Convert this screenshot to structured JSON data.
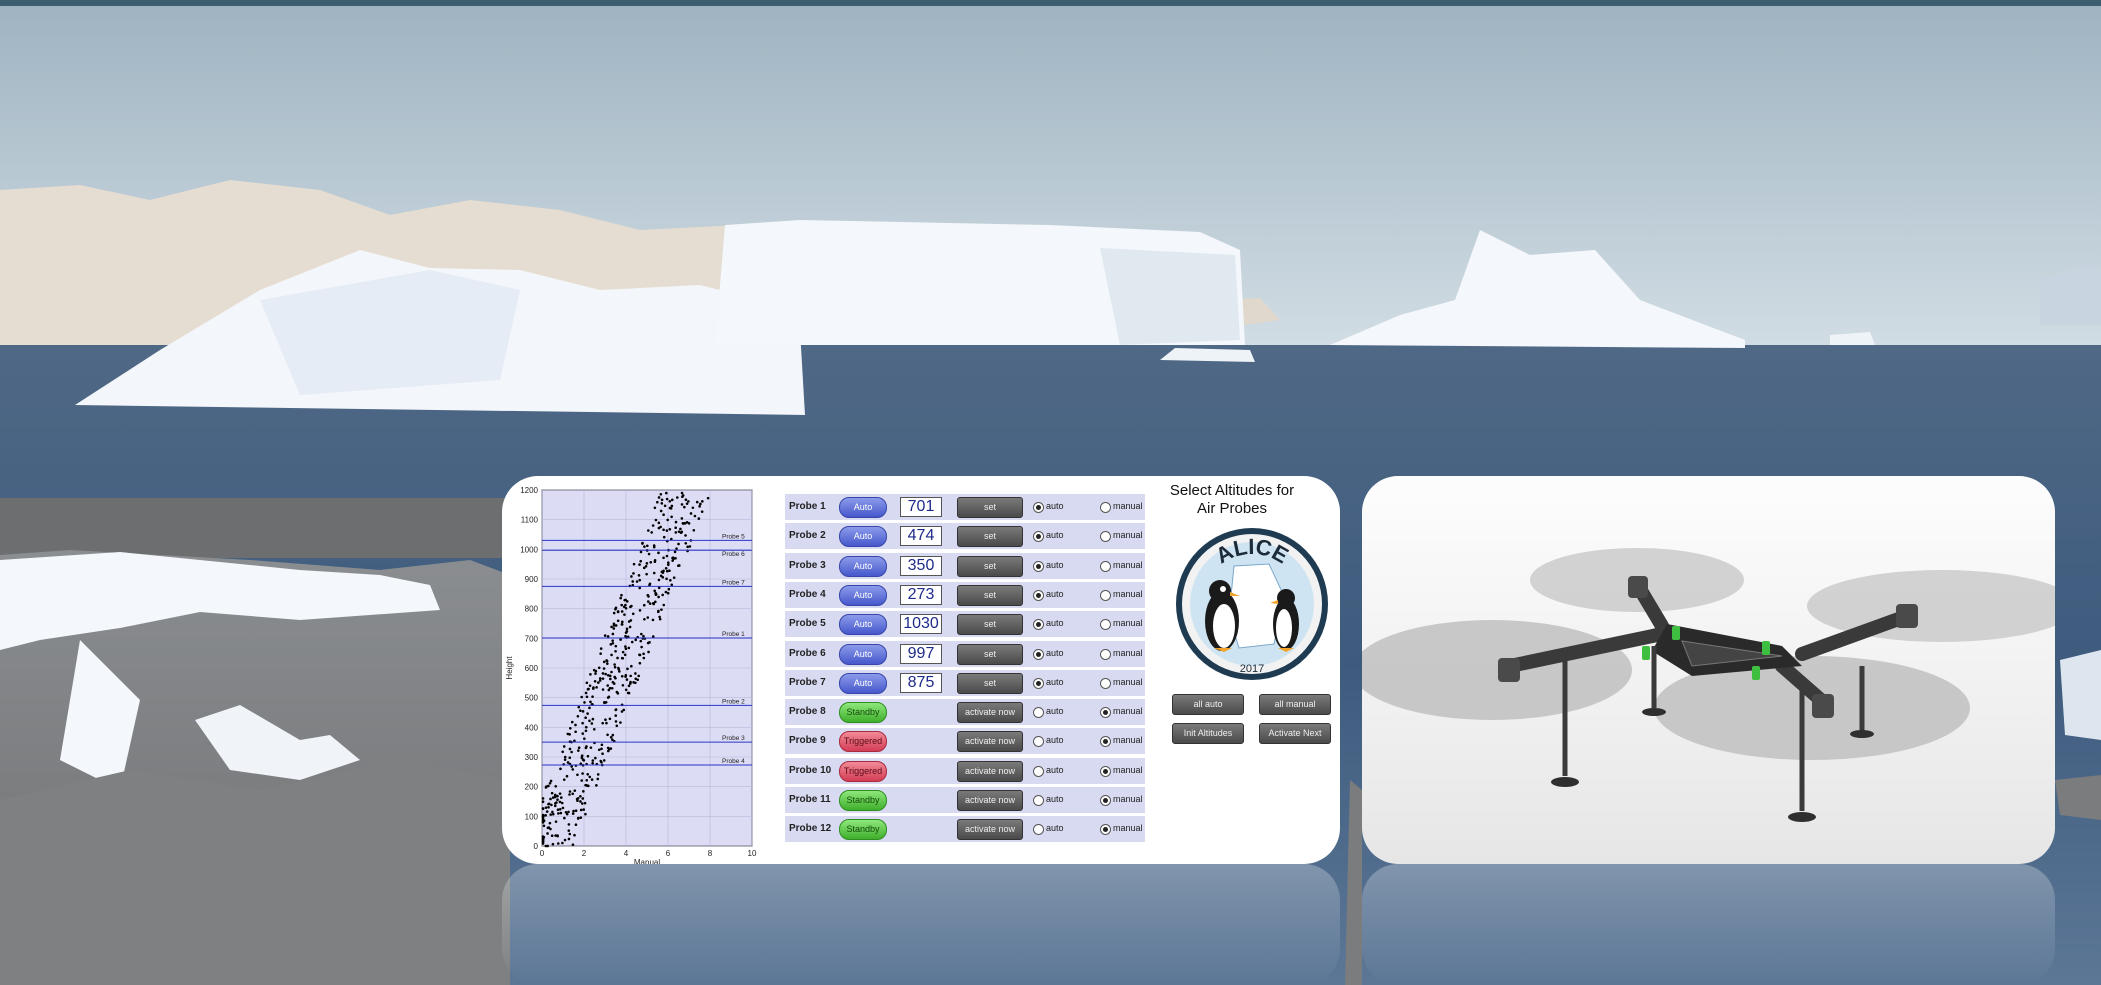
{
  "chart_data": {
    "type": "scatter",
    "xlabel": "Manual",
    "ylabel": "Height",
    "xlim": [
      0,
      10
    ],
    "ylim": [
      0,
      1200
    ],
    "x_ticks": [
      "0",
      "2",
      "4",
      "6",
      "8",
      "10"
    ],
    "y_ticks": [
      "0",
      "100",
      "200",
      "300",
      "400",
      "500",
      "600",
      "700",
      "800",
      "900",
      "1000",
      "1100",
      "1200"
    ],
    "probe_lines": [
      {
        "label": "Probe 5",
        "y": 1030
      },
      {
        "label": "Probe 6",
        "y": 997
      },
      {
        "label": "Probe 7",
        "y": 875
      },
      {
        "label": "Probe 1",
        "y": 701
      },
      {
        "label": "Probe 2",
        "y": 474
      },
      {
        "label": "Probe 3",
        "y": 350
      },
      {
        "label": "Probe 4",
        "y": 273
      }
    ],
    "scatter_note": "dense cloud of points drifting from x≈0 at height 0 to x≈7 at height 1200",
    "colors": {
      "background": "#dcdcf4",
      "line": "#2a35c8",
      "points": "#000000"
    }
  },
  "probes": [
    {
      "name": "Probe 1",
      "status": "Auto",
      "status_type": "auto",
      "altitude": "701",
      "action": "set",
      "mode": "auto"
    },
    {
      "name": "Probe 2",
      "status": "Auto",
      "status_type": "auto",
      "altitude": "474",
      "action": "set",
      "mode": "auto"
    },
    {
      "name": "Probe 3",
      "status": "Auto",
      "status_type": "auto",
      "altitude": "350",
      "action": "set",
      "mode": "auto"
    },
    {
      "name": "Probe 4",
      "status": "Auto",
      "status_type": "auto",
      "altitude": "273",
      "action": "set",
      "mode": "auto"
    },
    {
      "name": "Probe 5",
      "status": "Auto",
      "status_type": "auto",
      "altitude": "1030",
      "action": "set",
      "mode": "auto"
    },
    {
      "name": "Probe 6",
      "status": "Auto",
      "status_type": "auto",
      "altitude": "997",
      "action": "set",
      "mode": "auto"
    },
    {
      "name": "Probe 7",
      "status": "Auto",
      "status_type": "auto",
      "altitude": "875",
      "action": "set",
      "mode": "auto"
    },
    {
      "name": "Probe 8",
      "status": "Standby",
      "status_type": "standby",
      "altitude": "",
      "action": "activate now",
      "mode": "manual"
    },
    {
      "name": "Probe 9",
      "status": "Triggered",
      "status_type": "triggered",
      "altitude": "",
      "action": "activate now",
      "mode": "manual"
    },
    {
      "name": "Probe 10",
      "status": "Triggered",
      "status_type": "triggered",
      "altitude": "",
      "action": "activate now",
      "mode": "manual"
    },
    {
      "name": "Probe 11",
      "status": "Standby",
      "status_type": "standby",
      "altitude": "",
      "action": "activate now",
      "mode": "manual"
    },
    {
      "name": "Probe 12",
      "status": "Standby",
      "status_type": "standby",
      "altitude": "",
      "action": "activate now",
      "mode": "manual"
    }
  ],
  "radio_labels": {
    "auto": "auto",
    "manual": "manual"
  },
  "side": {
    "title_line1": "Select Altitudes for",
    "title_line2": "Air Probes",
    "logo_text": "ALICE",
    "logo_year": "2017",
    "buttons": {
      "all_auto": "all auto",
      "all_manual": "all manual",
      "init_altitudes": "Init Altitudes",
      "activate_next": "Activate Next"
    }
  },
  "colors": {
    "accent_auto": "#4a5ccf",
    "standby": "#45b332",
    "triggered": "#d64458",
    "row_bg": "#d8daf2"
  },
  "icons": {
    "drone": "quadcopter-drone-icon",
    "logo": "alice-penguin-logo-icon"
  }
}
